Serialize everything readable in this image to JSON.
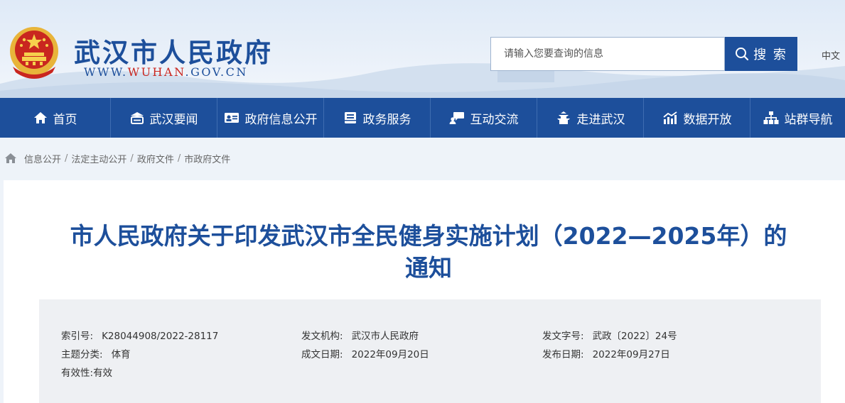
{
  "header": {
    "site_name": "武汉市人民政府",
    "url_prefix": "WWW.",
    "url_highlight": "WUHAN",
    "url_suffix": ".GOV.CN",
    "search_placeholder": "请输入您要查询的信息",
    "search_button": "搜 索",
    "language": "中文"
  },
  "nav": {
    "items": [
      {
        "label": "首页",
        "icon": "home-icon"
      },
      {
        "label": "武汉要闻",
        "icon": "news-icon"
      },
      {
        "label": "政府信息公开",
        "icon": "info-card-icon"
      },
      {
        "label": "政务服务",
        "icon": "service-icon"
      },
      {
        "label": "互动交流",
        "icon": "chat-icon"
      },
      {
        "label": "走进武汉",
        "icon": "tower-icon"
      },
      {
        "label": "数据开放",
        "icon": "data-chart-icon"
      },
      {
        "label": "站群导航",
        "icon": "sitemap-icon"
      }
    ]
  },
  "breadcrumb": [
    "信息公开",
    "法定主动公开",
    "政府文件",
    "市政府文件"
  ],
  "breadcrumb_separator": "/",
  "article": {
    "title": "市人民政府关于印发武汉市全民健身实施计划（2022—2025年）的通知",
    "meta": {
      "index_label": "索引号:",
      "index_value": "K28044908/2022-28117",
      "issuer_label": "发文机构:",
      "issuer_value": "武汉市人民政府",
      "doc_no_label": "发文字号:",
      "doc_no_value": "武政〔2022〕24号",
      "topic_label": "主题分类:",
      "topic_value": "体育",
      "created_label": "成文日期:",
      "created_value": "2022年09月20日",
      "published_label": "发布日期:",
      "published_value": "2022年09月27日",
      "validity_label": "有效性:",
      "validity_value": "有效"
    }
  },
  "colors": {
    "primary": "#1d4f9b",
    "emblem_red": "#c9261f",
    "emblem_gold": "#e8b43a"
  }
}
